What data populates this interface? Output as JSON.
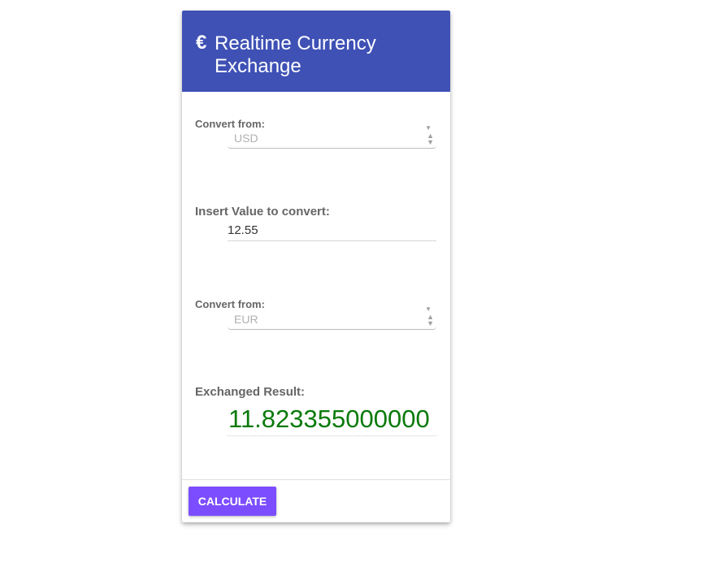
{
  "header": {
    "icon": "euro-icon",
    "icon_glyph": "€",
    "title": "Realtime Currency Exchange",
    "color": "#3f51b5"
  },
  "form": {
    "from_label": "Convert from:",
    "from_value": "USD",
    "value_label": "Insert Value to convert:",
    "value_input": "12.55",
    "to_label": "Convert from:",
    "to_value": "EUR",
    "result_label": "Exchanged Result:",
    "result_value": "11.823355000000",
    "result_color": "#0a7a0a"
  },
  "footer": {
    "calculate_label": "CALCULATE",
    "button_color": "#7c4dff"
  }
}
